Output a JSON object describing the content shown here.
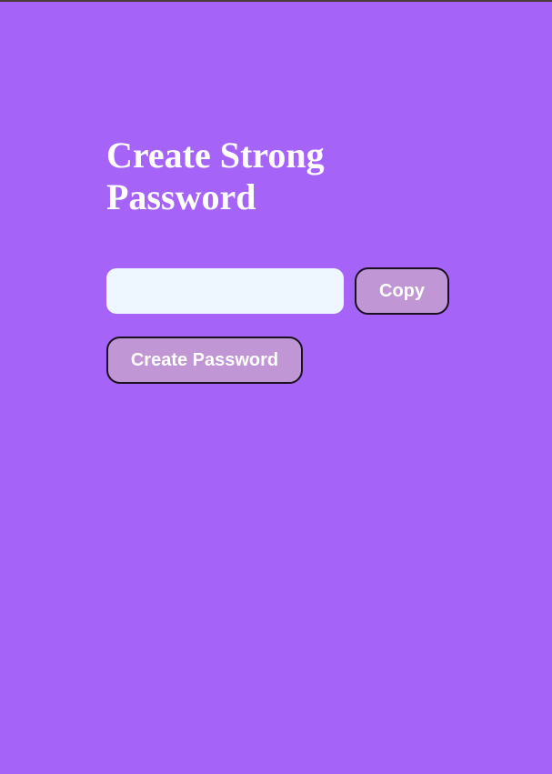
{
  "header": {
    "title": "Create Strong Password"
  },
  "password_field": {
    "value": "",
    "placeholder": ""
  },
  "actions": {
    "copy_label": "Copy",
    "create_label": "Create Password"
  },
  "colors": {
    "background": "#a563f7",
    "button": "#c097d4",
    "input": "#eef6ff",
    "text": "#ffffff"
  }
}
